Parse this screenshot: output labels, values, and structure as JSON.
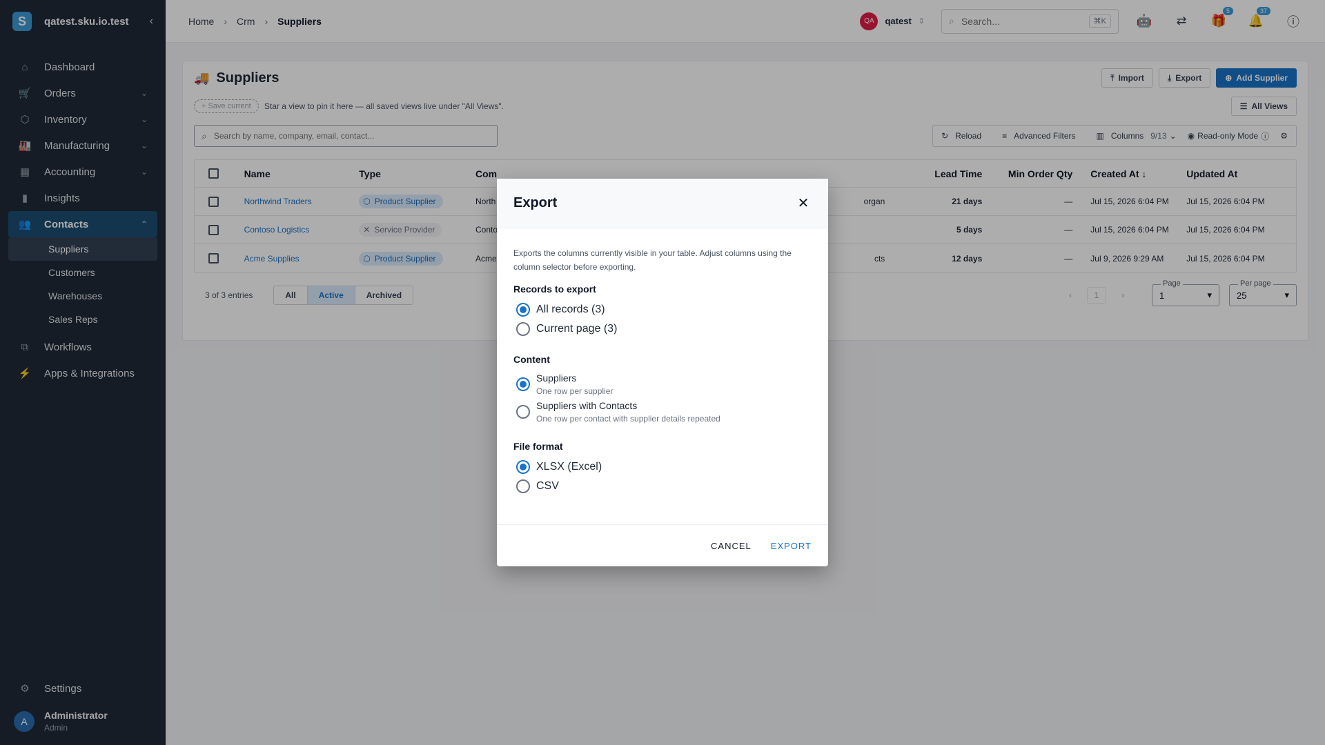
{
  "sidebar": {
    "brand": "qatest.sku.io.test",
    "brand_initial": "S",
    "collapse": "‹",
    "nav": [
      {
        "label": "Dashboard",
        "icon": "⌂"
      },
      {
        "label": "Orders",
        "icon": "🛒",
        "chev": "⌄"
      },
      {
        "label": "Inventory",
        "icon": "⬡",
        "chev": "⌄"
      },
      {
        "label": "Manufacturing",
        "icon": "🏭",
        "chev": "⌄"
      },
      {
        "label": "Accounting",
        "icon": "▦",
        "chev": "⌄"
      },
      {
        "label": "Insights",
        "icon": "▮"
      },
      {
        "label": "Contacts",
        "icon": "👥",
        "chev": "⌃"
      }
    ],
    "sub": [
      "Suppliers",
      "Customers",
      "Warehouses",
      "Sales Reps"
    ],
    "nav2": [
      {
        "label": "Workflows",
        "icon": "⧉"
      },
      {
        "label": "Apps & Integrations",
        "icon": "⚡"
      }
    ],
    "settings": "Settings",
    "user": {
      "name": "Administrator",
      "role": "Admin",
      "initial": "A"
    }
  },
  "topbar": {
    "crumbs": [
      "Home",
      "Crm",
      "Suppliers"
    ],
    "tenant_badge": "QA",
    "tenant": "qatest",
    "search_placeholder": "Search...",
    "shortcut": "⌘K",
    "gift_count": "5",
    "notif_count": "37"
  },
  "card": {
    "title": "Suppliers",
    "import": "Import",
    "export": "Export",
    "add": "Add Supplier",
    "save_current": "Save current",
    "views_hint": "Star a view to pin it here — all saved views live under \"All Views\".",
    "all_views": "All Views",
    "table_search_placeholder": "Search by name, company, email, contact...",
    "reload": "Reload",
    "advanced": "Advanced Filters",
    "columns": "Columns",
    "columns_count": "9/13",
    "readonly": "Read-only Mode"
  },
  "table": {
    "headers": {
      "name": "Name",
      "type": "Type",
      "comp": "Com",
      "lead": "Lead Time",
      "min": "Min Order Qty",
      "created": "Created At",
      "sort": "↓",
      "updated": "Updated At"
    },
    "rows": [
      {
        "name": "Northwind Traders",
        "type": "Product Supplier",
        "type_kind": "product",
        "comp": "North",
        "comp_right": "organ",
        "lead": "21 days",
        "min": "—",
        "created": "Jul 15, 2026 6:04 PM",
        "updated": "Jul 15, 2026 6:04 PM"
      },
      {
        "name": "Contoso Logistics",
        "type": "Service Provider",
        "type_kind": "service",
        "comp": "Conto",
        "comp_right": "",
        "lead": "5 days",
        "min": "—",
        "created": "Jul 15, 2026 6:04 PM",
        "updated": "Jul 15, 2026 6:04 PM"
      },
      {
        "name": "Acme Supplies",
        "type": "Product Supplier",
        "type_kind": "product",
        "comp": "Acme",
        "comp_right": "cts",
        "lead": "12 days",
        "min": "—",
        "created": "Jul 9, 2026 9:29 AM",
        "updated": "Jul 15, 2026 6:04 PM"
      }
    ]
  },
  "footer": {
    "entries": "3 of 3 entries",
    "filters": [
      "All",
      "Active",
      "Archived"
    ],
    "active_filter": "Active",
    "page_num": "1",
    "page_label": "Page",
    "page_value": "1",
    "per_page_label": "Per page",
    "per_page_value": "25"
  },
  "dialog": {
    "title": "Export",
    "description": "Exports the columns currently visible in your table. Adjust columns using the column selector before exporting.",
    "records_label": "Records to export",
    "records": [
      {
        "label": "All records (3)",
        "selected": true
      },
      {
        "label": "Current page (3)",
        "selected": false
      }
    ],
    "content_label": "Content",
    "content": [
      {
        "label": "Suppliers",
        "sub": "One row per supplier",
        "selected": true
      },
      {
        "label": "Suppliers with Contacts",
        "sub": "One row per contact with supplier details repeated",
        "selected": false
      }
    ],
    "format_label": "File format",
    "formats": [
      {
        "label": "XLSX (Excel)",
        "selected": true
      },
      {
        "label": "CSV",
        "selected": false
      }
    ],
    "cancel": "CANCEL",
    "export": "EXPORT"
  }
}
